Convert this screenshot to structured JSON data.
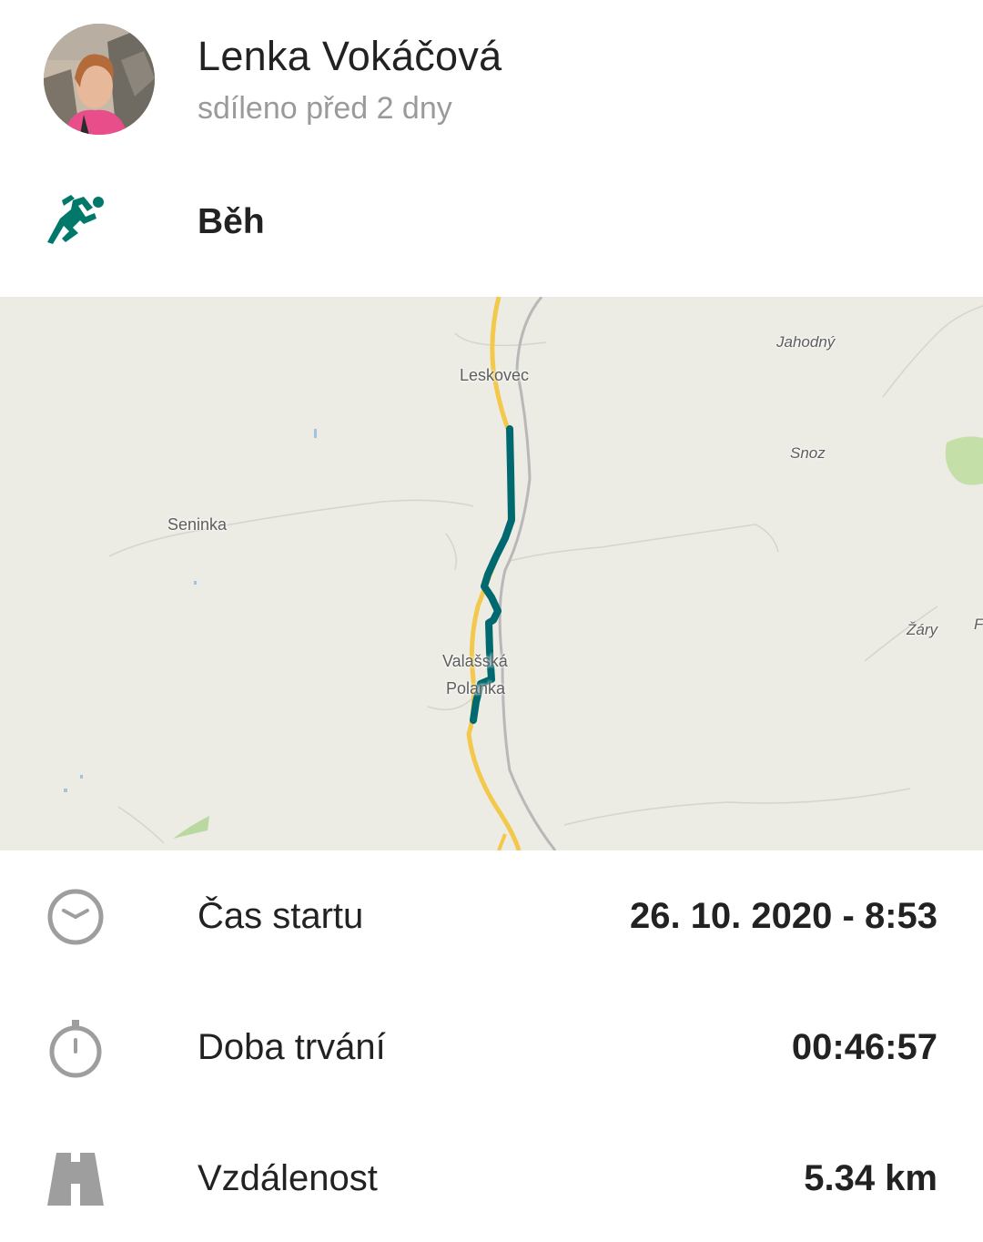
{
  "header": {
    "user_name": "Lenka Vokáčová",
    "shared_text": "sdíleno před 2 dny"
  },
  "activity": {
    "icon": "running-person-icon",
    "label": "Běh"
  },
  "map": {
    "places": {
      "leskovec": "Leskovec",
      "seninka": "Seninka",
      "jahodny": "Jahodný",
      "snoz": "Snoz",
      "zary": "Žáry",
      "valasska_line1": "Valašská",
      "valasska_line2": "Polanka",
      "edge_letter": "F"
    },
    "route_color": "#00696f",
    "road_color": "#f2c94c"
  },
  "stats": [
    {
      "icon": "clock-icon",
      "label": "Čas startu",
      "value": "26. 10. 2020 - 8:53"
    },
    {
      "icon": "stopwatch-icon",
      "label": "Doba trvání",
      "value": "00:46:57"
    },
    {
      "icon": "road-icon",
      "label": "Vzdálenost",
      "value": "5.34 km"
    }
  ],
  "colors": {
    "accent": "#00796b",
    "icon_gray": "#9e9e9e"
  }
}
